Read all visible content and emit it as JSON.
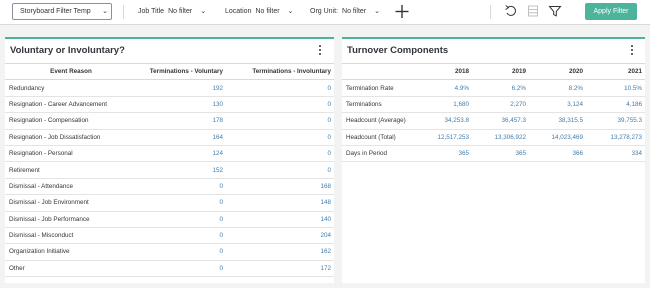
{
  "toolbar": {
    "template_select": "Storyboard Filter Temp",
    "filters": [
      {
        "label": "Job Title",
        "value": "No filter"
      },
      {
        "label": "Location",
        "value": "No filter"
      },
      {
        "label": "Org Unit:",
        "value": "No filter"
      }
    ],
    "apply_label": "Apply Filter",
    "accent_color": "#4db49b"
  },
  "left_panel": {
    "title": "Voluntary or Involuntary?",
    "columns": [
      "Event Reason",
      "Terminations - Voluntary",
      "Terminations - Involuntary"
    ],
    "rows": [
      [
        "Redundancy",
        "192",
        "0"
      ],
      [
        "Resignation - Career Advancement",
        "130",
        "0"
      ],
      [
        "Resignation - Compensation",
        "178",
        "0"
      ],
      [
        "Resignation - Job Dissatisfaction",
        "164",
        "0"
      ],
      [
        "Resignation - Personal",
        "124",
        "0"
      ],
      [
        "Retirement",
        "152",
        "0"
      ],
      [
        "Dismissal - Attendance",
        "0",
        "168"
      ],
      [
        "Dismissal - Job Environment",
        "0",
        "148"
      ],
      [
        "Dismissal - Job Performance",
        "0",
        "140"
      ],
      [
        "Dismissal - Misconduct",
        "0",
        "204"
      ],
      [
        "Organization Initiative",
        "0",
        "162"
      ],
      [
        "Other",
        "0",
        "172"
      ]
    ]
  },
  "right_panel": {
    "title": "Turnover Components",
    "columns": [
      "",
      "2018",
      "2019",
      "2020",
      "2021"
    ],
    "rows": [
      [
        "Termination Rate",
        "4.9%",
        "6.2%",
        "8.2%",
        "10.5%"
      ],
      [
        "Terminations",
        "1,680",
        "2,270",
        "3,124",
        "4,186"
      ],
      [
        "Headcount (Average)",
        "34,253.8",
        "36,457.3",
        "38,315.5",
        "39,755.3"
      ],
      [
        "Headcount (Total)",
        "12,517,253",
        "13,306,922",
        "14,023,469",
        "13,278,273"
      ],
      [
        "Days in Period",
        "365",
        "365",
        "366",
        "334"
      ]
    ]
  }
}
